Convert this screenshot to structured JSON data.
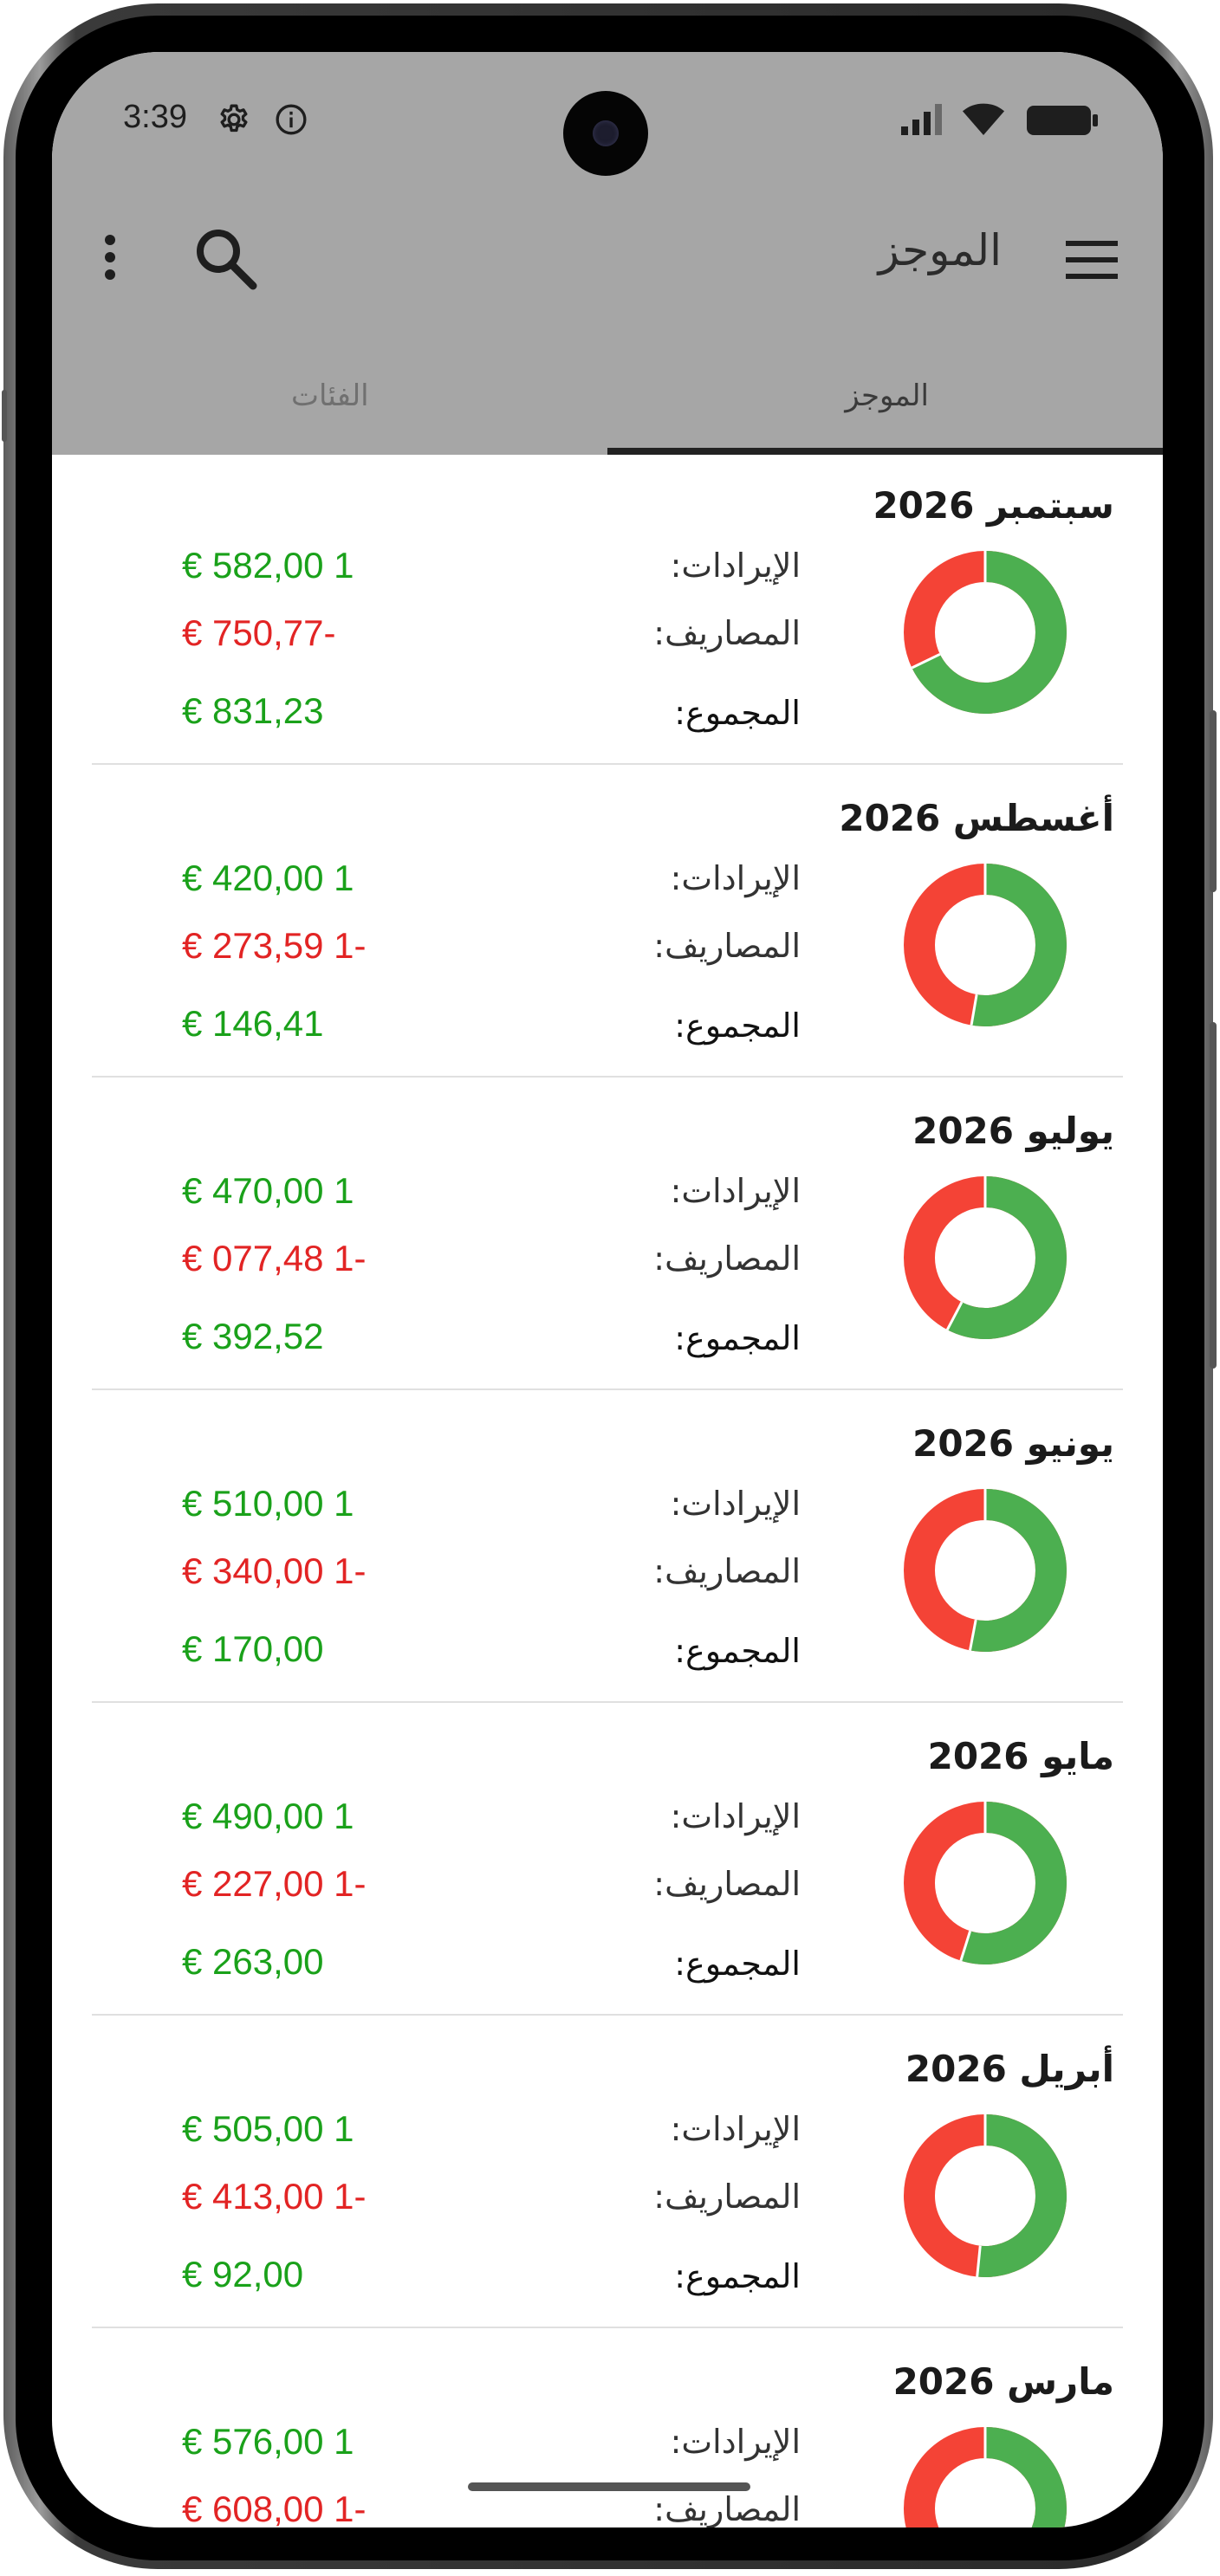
{
  "status_bar": {
    "time": "3:39"
  },
  "toolbar": {
    "title": "الموجز"
  },
  "tabs": [
    {
      "label": "الموجز",
      "selected": true
    },
    {
      "label": "الفئات",
      "selected": false
    }
  ],
  "labels": {
    "income": "الإيرادات:",
    "expenses": "المصاريف:",
    "total": "المجموع:"
  },
  "colors": {
    "income": "#4caf50",
    "expense": "#f44336",
    "income_text": "#1aa11a",
    "expense_text": "#e22424"
  },
  "months": [
    {
      "title": "سبتمبر 2026",
      "income": "1 582,00 €",
      "expenses": "-750,77 €",
      "total": "831,23 €",
      "income_value": 1582.0,
      "expense_value": 750.77
    },
    {
      "title": "أغسطس 2026",
      "income": "1 420,00 €",
      "expenses": "-1 273,59 €",
      "total": "146,41 €",
      "income_value": 1420.0,
      "expense_value": 1273.59
    },
    {
      "title": "يوليو 2026",
      "income": "1 470,00 €",
      "expenses": "-1 077,48 €",
      "total": "392,52 €",
      "income_value": 1470.0,
      "expense_value": 1077.48
    },
    {
      "title": "يونيو 2026",
      "income": "1 510,00 €",
      "expenses": "-1 340,00 €",
      "total": "170,00 €",
      "income_value": 1510.0,
      "expense_value": 1340.0
    },
    {
      "title": "مايو 2026",
      "income": "1 490,00 €",
      "expenses": "-1 227,00 €",
      "total": "263,00 €",
      "income_value": 1490.0,
      "expense_value": 1227.0
    },
    {
      "title": "أبريل 2026",
      "income": "1 505,00 €",
      "expenses": "-1 413,00 €",
      "total": "92,00 €",
      "income_value": 1505.0,
      "expense_value": 1413.0
    },
    {
      "title": "مارس 2026",
      "income": "1 576,00 €",
      "expenses": "-1 608,00 €",
      "total": "",
      "income_value": 1576.0,
      "expense_value": 1608.0
    }
  ]
}
